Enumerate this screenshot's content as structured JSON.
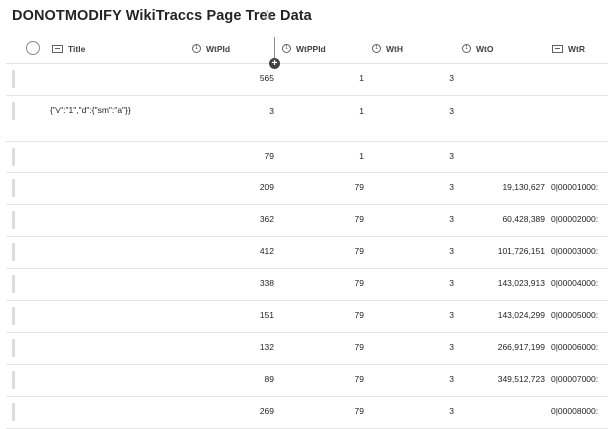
{
  "page": {
    "title": "DONOTMODIFY WikiTraccs Page Tree Data",
    "star_icon": "star-outline-icon"
  },
  "columns": [
    "Title",
    "WtPId",
    "WtPPId",
    "WtH",
    "WtO",
    "WtR"
  ],
  "rows": [
    {
      "title": "",
      "wtpid": "565",
      "wtppid": "1",
      "wth": "3",
      "wto": "",
      "wtr": ""
    },
    {
      "title": "{\"v\":\"1\",\"d\":{\"sm\":\"a\"}}",
      "wtpid": "3",
      "wtppid": "1",
      "wth": "3",
      "wto": "",
      "wtr": ""
    },
    {
      "title": "",
      "wtpid": "79",
      "wtppid": "1",
      "wth": "3",
      "wto": "",
      "wtr": ""
    },
    {
      "title": "",
      "wtpid": "209",
      "wtppid": "79",
      "wth": "3",
      "wto": "19,130,627",
      "wtr": "0|00001000:"
    },
    {
      "title": "",
      "wtpid": "362",
      "wtppid": "79",
      "wth": "3",
      "wto": "60,428,389",
      "wtr": "0|00002000:"
    },
    {
      "title": "",
      "wtpid": "412",
      "wtppid": "79",
      "wth": "3",
      "wto": "101,726,151",
      "wtr": "0|00003000:"
    },
    {
      "title": "",
      "wtpid": "338",
      "wtppid": "79",
      "wth": "3",
      "wto": "143,023,913",
      "wtr": "0|00004000:"
    },
    {
      "title": "",
      "wtpid": "151",
      "wtppid": "79",
      "wth": "3",
      "wto": "143,024,299",
      "wtr": "0|00005000:"
    },
    {
      "title": "",
      "wtpid": "132",
      "wtppid": "79",
      "wth": "3",
      "wto": "266,917,199",
      "wtr": "0|00006000:"
    },
    {
      "title": "",
      "wtpid": "89",
      "wtppid": "79",
      "wth": "3",
      "wto": "349,512,723",
      "wtr": "0|00007000:"
    },
    {
      "title": "",
      "wtpid": "269",
      "wtppid": "79",
      "wth": "3",
      "wto": "",
      "wtr": "0|00008000:"
    }
  ]
}
